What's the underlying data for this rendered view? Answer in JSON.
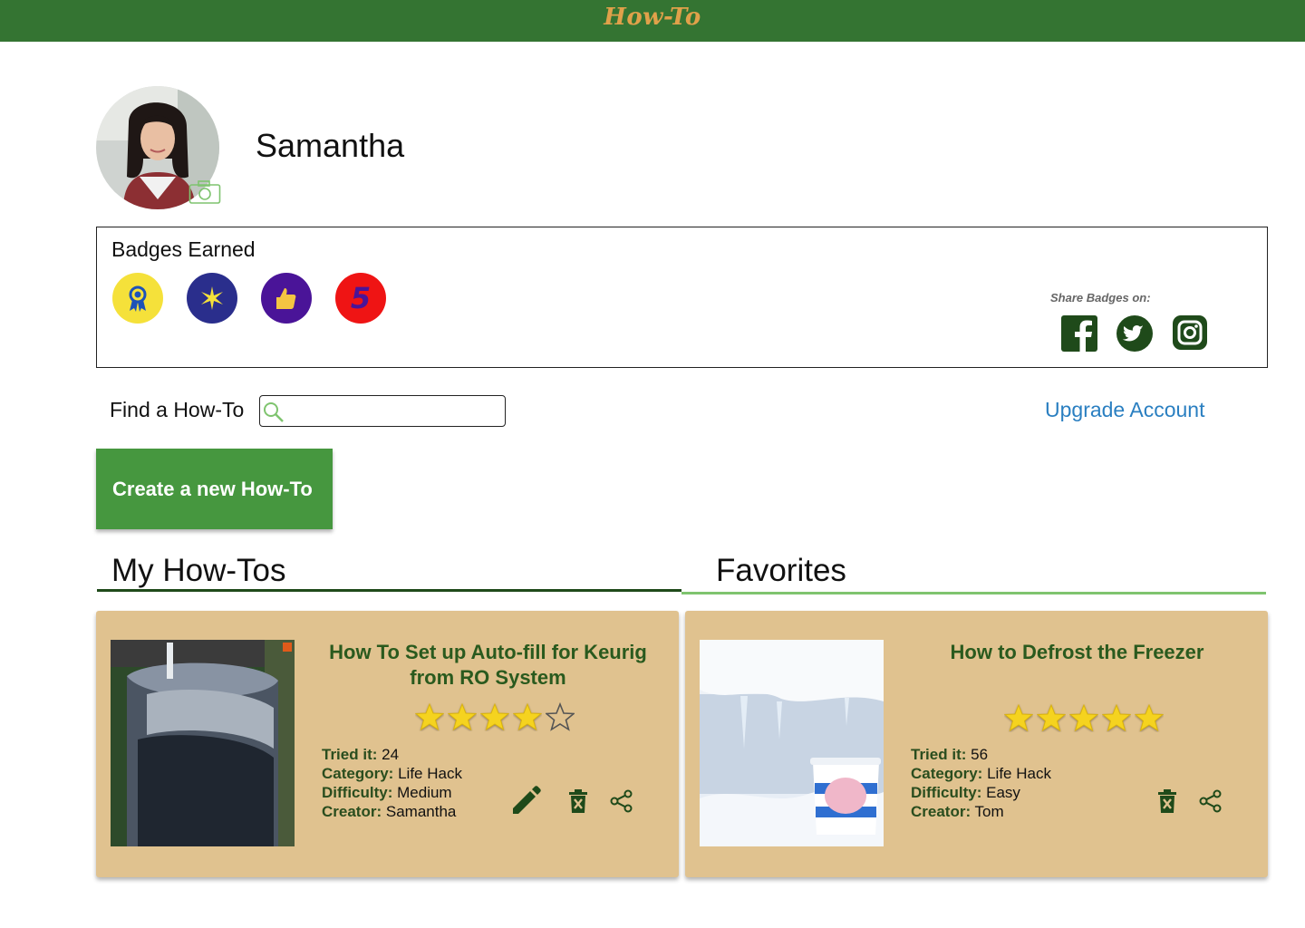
{
  "app": {
    "brand": "How-To"
  },
  "profile": {
    "name": "Samantha"
  },
  "badges": {
    "title": "Badges Earned",
    "items": [
      {
        "name": "ribbon-badge",
        "color": "#f5e13a"
      },
      {
        "name": "star-burst-badge",
        "color": "#2a2e8c"
      },
      {
        "name": "thumbs-up-badge",
        "color": "#4a1498"
      },
      {
        "name": "five-badge",
        "color": "#ef1414",
        "text": "5"
      }
    ],
    "share_label": "Share Badges on:"
  },
  "search": {
    "label": "Find a How-To",
    "value": "",
    "placeholder": ""
  },
  "upgrade_label": "Upgrade Account",
  "create_label": "Create a new How-To",
  "tabs": {
    "mine": "My How-Tos",
    "favorites": "Favorites"
  },
  "my_howto": {
    "title": "How To Set up Auto-fill for Keurig from RO System",
    "rating": 4,
    "tried_label": "Tried it:",
    "tried": "24",
    "category_label": "Category:",
    "category": "Life Hack",
    "difficulty_label": "Difficulty:",
    "difficulty": "Medium",
    "creator_label": "Creator:",
    "creator": "Samantha"
  },
  "favorite_howto": {
    "title": "How to Defrost the Freezer",
    "rating": 5,
    "tried_label": "Tried it:",
    "tried": "56",
    "category_label": "Category:",
    "category": "Life Hack",
    "difficulty_label": "Difficulty:",
    "difficulty": "Easy",
    "creator_label": "Creator:",
    "creator": "Tom"
  },
  "colors": {
    "header": "#347432",
    "brand": "#e0a14a",
    "accent": "#46973f",
    "card": "#e0c28f",
    "icon": "#1f4a1a",
    "star": "#f5d31f"
  }
}
